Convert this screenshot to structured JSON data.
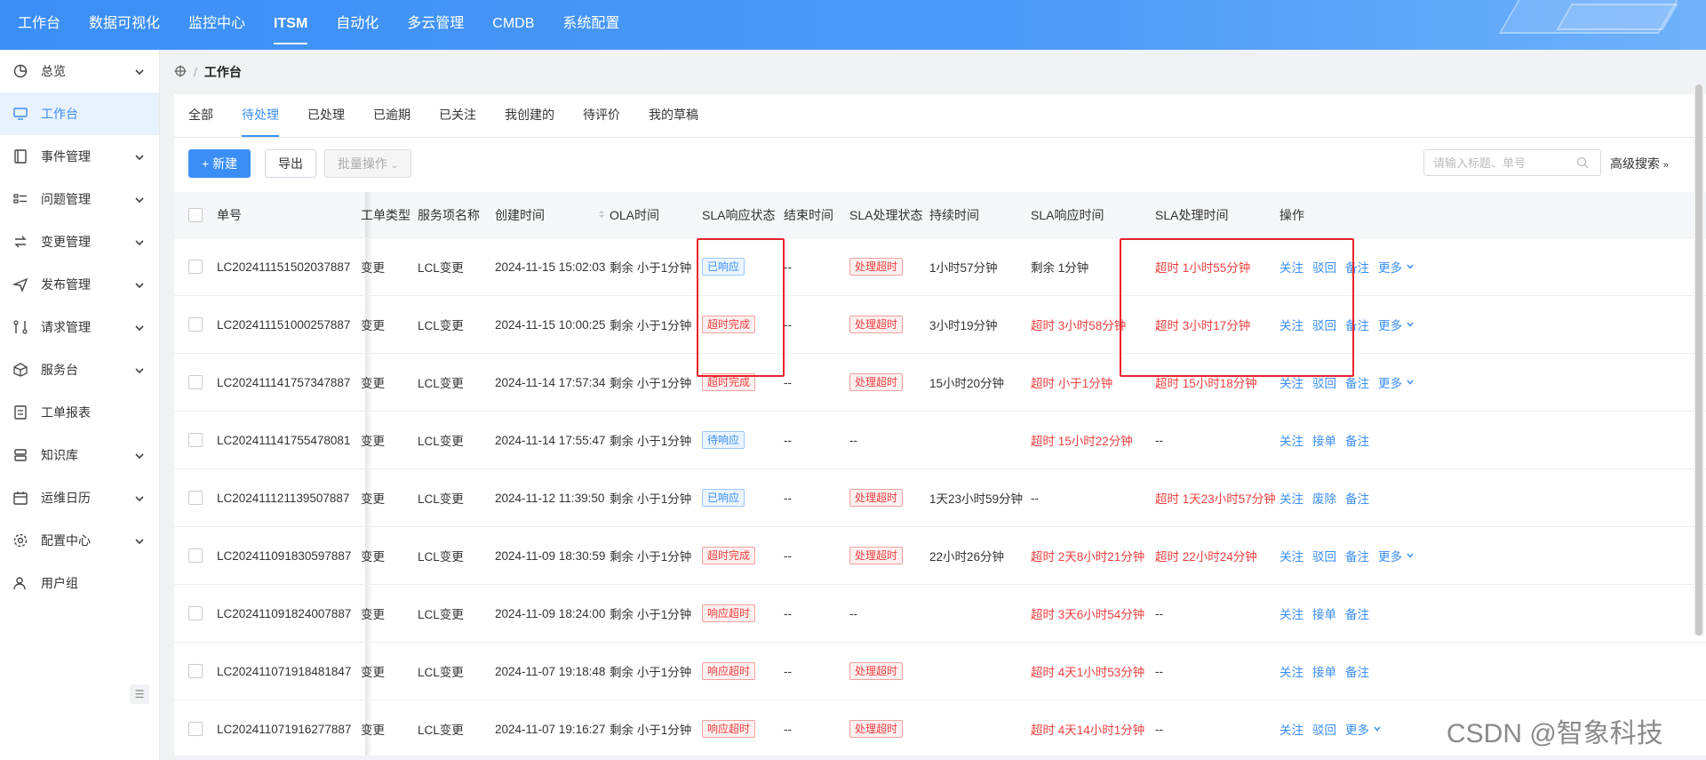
{
  "topnav": {
    "items": [
      "工作台",
      "数据可视化",
      "监控中心",
      "ITSM",
      "自动化",
      "多云管理",
      "CMDB",
      "系统配置"
    ],
    "active": "ITSM"
  },
  "sidebar": {
    "items": [
      {
        "label": "总览",
        "icon": "dashboard-icon",
        "expandable": true
      },
      {
        "label": "工作台",
        "icon": "monitor-icon",
        "expandable": false,
        "active": true
      },
      {
        "label": "事件管理",
        "icon": "book-icon",
        "expandable": true
      },
      {
        "label": "问题管理",
        "icon": "list-icon",
        "expandable": true
      },
      {
        "label": "变更管理",
        "icon": "change-icon",
        "expandable": true
      },
      {
        "label": "发布管理",
        "icon": "send-icon",
        "expandable": true
      },
      {
        "label": "请求管理",
        "icon": "request-icon",
        "expandable": true
      },
      {
        "label": "服务台",
        "icon": "cube-icon",
        "expandable": true
      },
      {
        "label": "工单报表",
        "icon": "report-icon",
        "expandable": false
      },
      {
        "label": "知识库",
        "icon": "database-icon",
        "expandable": true
      },
      {
        "label": "运维日历",
        "icon": "calendar-icon",
        "expandable": true
      },
      {
        "label": "配置中心",
        "icon": "gear-icon",
        "expandable": true
      },
      {
        "label": "用户组",
        "icon": "user-group-icon",
        "expandable": false
      }
    ]
  },
  "breadcrumb": {
    "current": "工作台",
    "sep": "/"
  },
  "tabs": [
    "全部",
    "待处理",
    "已处理",
    "已逾期",
    "已关注",
    "我创建的",
    "待评价",
    "我的草稿"
  ],
  "toolbar": {
    "new_label": "+ 新建",
    "export_label": "导出",
    "batch_label": "批量操作",
    "search_placeholder": "请输入标题、单号",
    "adv_search_label": "高级搜索"
  },
  "table": {
    "headers": [
      "单号",
      "工单类型",
      "服务项名称",
      "创建时间",
      "OLA时间",
      "SLA响应状态",
      "结束时间",
      "SLA处理状态",
      "持续时间",
      "SLA响应时间",
      "SLA处理时间",
      "操作"
    ],
    "rows": [
      {
        "id": "LC202411151502037887",
        "type": "变更",
        "service": "LCL变更",
        "created": "2024-11-15 15:02:03",
        "ola": "剩余 小于1分钟",
        "resp_status": "已响应",
        "resp_color": "blue",
        "end": "--",
        "proc_status": "处理超时",
        "duration": "1小时57分钟",
        "resp_time": "剩余 1分钟",
        "resp_time_red": false,
        "proc_time": "超时 1小时55分钟",
        "proc_time_red": true,
        "actions": [
          "关注",
          "驳回",
          "备注",
          "更多"
        ]
      },
      {
        "id": "LC202411151000257887",
        "type": "变更",
        "service": "LCL变更",
        "created": "2024-11-15 10:00:25",
        "ola": "剩余 小于1分钟",
        "resp_status": "超时完成",
        "resp_color": "red",
        "end": "--",
        "proc_status": "处理超时",
        "duration": "3小时19分钟",
        "resp_time": "超时 3小时58分钟",
        "resp_time_red": true,
        "proc_time": "超时 3小时17分钟",
        "proc_time_red": true,
        "actions": [
          "关注",
          "驳回",
          "备注",
          "更多"
        ]
      },
      {
        "id": "LC202411141757347887",
        "type": "变更",
        "service": "LCL变更",
        "created": "2024-11-14 17:57:34",
        "ola": "剩余 小于1分钟",
        "resp_status": "超时完成",
        "resp_color": "red",
        "end": "--",
        "proc_status": "处理超时",
        "duration": "15小时20分钟",
        "resp_time": "超时 小于1分钟",
        "resp_time_red": true,
        "proc_time": "超时 15小时18分钟",
        "proc_time_red": true,
        "actions": [
          "关注",
          "驳回",
          "备注",
          "更多"
        ]
      },
      {
        "id": "LC202411141755478081",
        "type": "变更",
        "service": "LCL变更",
        "created": "2024-11-14 17:55:47",
        "ola": "剩余 小于1分钟",
        "resp_status": "待响应",
        "resp_color": "blue",
        "end": "--",
        "proc_status": "",
        "proc_text": "--",
        "duration": "",
        "resp_time": "超时 15小时22分钟",
        "resp_time_red": true,
        "proc_time": "--",
        "proc_time_red": false,
        "actions": [
          "关注",
          "接单",
          "备注"
        ]
      },
      {
        "id": "LC202411121139507887",
        "type": "变更",
        "service": "LCL变更",
        "created": "2024-11-12 11:39:50",
        "ola": "剩余 小于1分钟",
        "resp_status": "已响应",
        "resp_color": "blue",
        "end": "--",
        "proc_status": "处理超时",
        "duration": "1天23小时59分钟",
        "resp_time": "--",
        "resp_time_red": false,
        "proc_time": "超时 1天23小时57分钟",
        "proc_time_red": true,
        "actions": [
          "关注",
          "废除",
          "备注"
        ]
      },
      {
        "id": "LC202411091830597887",
        "type": "变更",
        "service": "LCL变更",
        "created": "2024-11-09 18:30:59",
        "ola": "剩余 小于1分钟",
        "resp_status": "超时完成",
        "resp_color": "red",
        "end": "--",
        "proc_status": "处理超时",
        "duration": "22小时26分钟",
        "resp_time": "超时 2天8小时21分钟",
        "resp_time_red": true,
        "proc_time": "超时 22小时24分钟",
        "proc_time_red": true,
        "actions": [
          "关注",
          "驳回",
          "备注",
          "更多"
        ]
      },
      {
        "id": "LC202411091824007887",
        "type": "变更",
        "service": "LCL变更",
        "created": "2024-11-09 18:24:00",
        "ola": "剩余 小于1分钟",
        "resp_status": "响应超时",
        "resp_color": "red",
        "end": "--",
        "proc_status": "",
        "proc_text": "--",
        "duration": "",
        "resp_time": "超时 3天6小时54分钟",
        "resp_time_red": true,
        "proc_time": "--",
        "proc_time_red": false,
        "actions": [
          "关注",
          "接单",
          "备注"
        ]
      },
      {
        "id": "LC202411071918481847",
        "type": "变更",
        "service": "LCL变更",
        "created": "2024-11-07 19:18:48",
        "ola": "剩余 小于1分钟",
        "resp_status": "响应超时",
        "resp_color": "red",
        "end": "--",
        "proc_status": "处理超时",
        "duration": "",
        "resp_time": "超时 4天1小时53分钟",
        "resp_time_red": true,
        "proc_time": "--",
        "proc_time_red": false,
        "actions": [
          "关注",
          "接单",
          "备注"
        ]
      },
      {
        "id": "LC202411071916277887",
        "type": "变更",
        "service": "LCL变更",
        "created": "2024-11-07 19:16:27",
        "ola": "剩余 小于1分钟",
        "resp_status": "响应超时",
        "resp_color": "red",
        "end": "--",
        "proc_status": "处理超时",
        "duration": "",
        "resp_time": "超时 4天14小时1分钟",
        "resp_time_red": true,
        "proc_time": "--",
        "proc_time_red": false,
        "actions": [
          "关注",
          "驳回",
          "更多"
        ]
      }
    ]
  },
  "watermark": "CSDN @智象科技",
  "colors": {
    "primary": "#3a8ef5",
    "danger": "#f04040",
    "highlight": "#e8242c"
  }
}
